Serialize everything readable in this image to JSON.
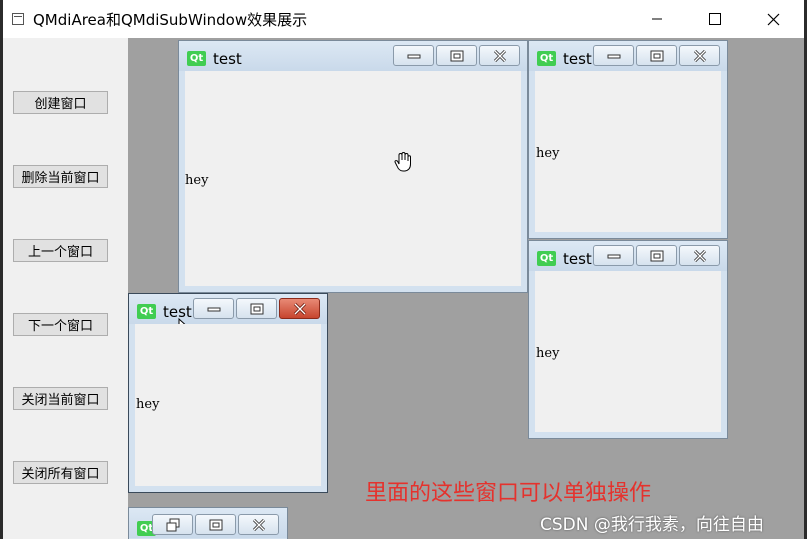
{
  "app": {
    "title": "QMdiArea和QMdiSubWindow效果展示"
  },
  "sidebar": {
    "buttons": [
      {
        "label": "创建窗口"
      },
      {
        "label": "删除当前窗口"
      },
      {
        "label": "上一个窗口"
      },
      {
        "label": "下一个窗口"
      },
      {
        "label": "关闭当前窗口"
      },
      {
        "label": "关闭所有窗口"
      }
    ]
  },
  "mdi": {
    "subwindows": [
      {
        "title": "test",
        "body": "hey",
        "icon": "Qt"
      },
      {
        "title": "test",
        "body": "hey",
        "icon": "Qt"
      },
      {
        "title": "test",
        "body": "hey",
        "icon": "Qt"
      },
      {
        "title": "test",
        "body": "hey",
        "icon": "Qt"
      },
      {
        "icon": "Qt"
      }
    ]
  },
  "annotation": {
    "text": "里面的这些窗口可以单独操作",
    "color": "#e5322d"
  },
  "watermark": {
    "text": "CSDN @我行我素，向往自由"
  },
  "colors": {
    "mdi_background": "#a0a0a0",
    "active_close": "#c7452e"
  }
}
